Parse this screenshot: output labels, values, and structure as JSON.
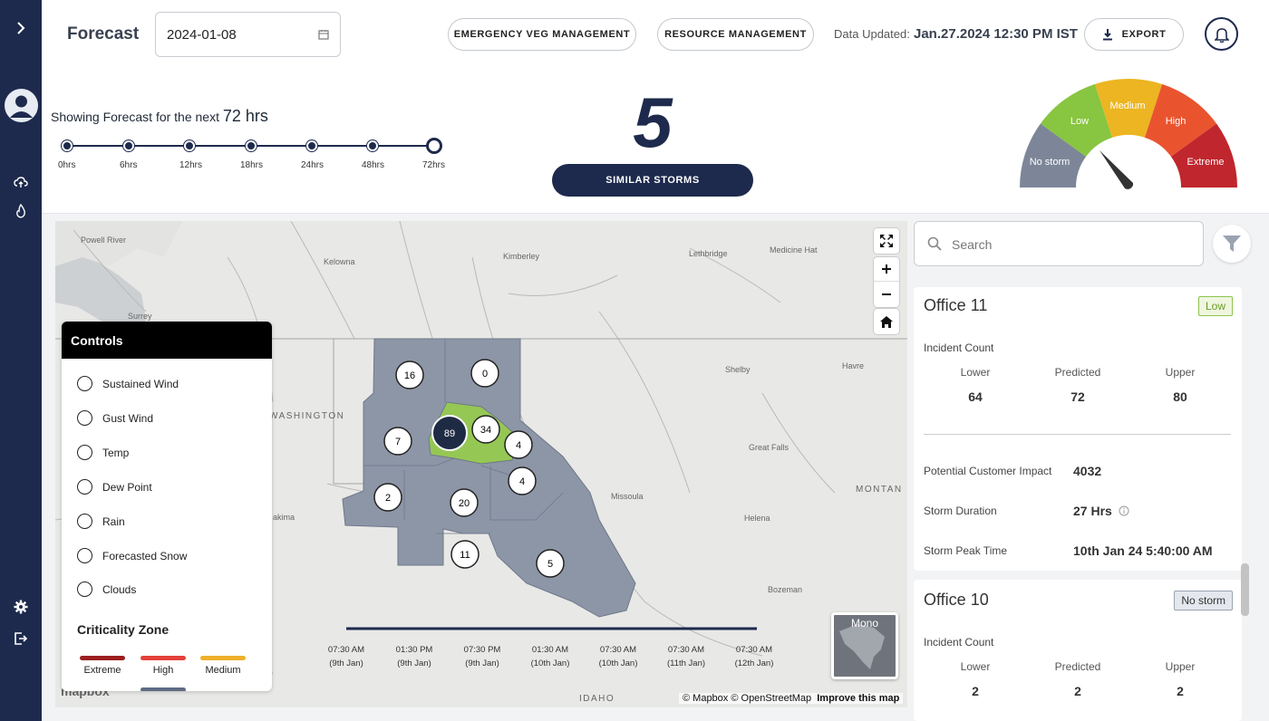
{
  "header": {
    "title": "Forecast",
    "date_value": "2024-01-08",
    "emergency_btn": "EMERGENCY VEG MANAGEMENT",
    "resource_btn": "RESOURCE MANAGEMENT",
    "data_updated_label": "Data Updated:",
    "data_updated_value": "Jan.27.2024 12:30 PM IST",
    "export_btn": "EXPORT"
  },
  "forecast": {
    "prefix": "Showing Forecast for the next",
    "hours": "72 hrs",
    "timeline_labels": [
      "0hrs",
      "6hrs",
      "12hrs",
      "18hrs",
      "24hrs",
      "48hrs",
      "72hrs"
    ]
  },
  "storms": {
    "count": "5",
    "similar_btn": "SIMILAR STORMS"
  },
  "gauge": {
    "labels": [
      "No storm",
      "Low",
      "Medium",
      "High",
      "Extreme"
    ],
    "colors": [
      "#7d8698",
      "#88c540",
      "#ecb521",
      "#e9542f",
      "#c0262d"
    ]
  },
  "map": {
    "place_labels": [
      "Powell River",
      "Kelowna",
      "Surrey",
      "Kimberley",
      "Lethbridge",
      "Medicine Hat",
      "Shelby",
      "Havre",
      "WASHINGTON",
      "Great Falls",
      "Missoula",
      "MONTAN",
      "Helena",
      "akima",
      "Bozeman",
      "IDAHO"
    ],
    "clusters": [
      "16",
      "0",
      "89",
      "34",
      "7",
      "4",
      "4",
      "2",
      "20",
      "11",
      "5"
    ],
    "time_labels": [
      [
        "07:30 AM",
        "(9th Jan)"
      ],
      [
        "01:30 PM",
        "(9th Jan)"
      ],
      [
        "07:30 PM",
        "(9th Jan)"
      ],
      [
        "01:30 AM",
        "(10th Jan)"
      ],
      [
        "07:30 AM",
        "(10th Jan)"
      ],
      [
        "07:30 AM",
        "(11th Jan)"
      ],
      [
        "07:30 AM",
        "(12th Jan)"
      ]
    ],
    "mini_map_label": "Mono",
    "attribution": "© Mapbox © OpenStreetMap",
    "improve": "Improve this map",
    "logo": "mapbox"
  },
  "controls": {
    "title": "Controls",
    "items": [
      "Sustained Wind",
      "Gust Wind",
      "Temp",
      "Dew Point",
      "Rain",
      "Forecasted Snow",
      "Clouds"
    ],
    "criticality_title": "Criticality Zone",
    "zones": [
      {
        "label": "Extreme",
        "color": "#9c1f1f"
      },
      {
        "label": "High",
        "color": "#e2413a"
      },
      {
        "label": "Medium",
        "color": "#efb02b"
      }
    ]
  },
  "panel": {
    "search_placeholder": "Search",
    "cards": [
      {
        "name": "Office 11",
        "badge": "Low",
        "incident_label": "Incident Count",
        "cols": [
          "Lower",
          "Predicted",
          "Upper"
        ],
        "values": [
          "64",
          "72",
          "80"
        ],
        "impact_label": "Potential Customer Impact",
        "impact_value": "4032",
        "duration_label": "Storm Duration",
        "duration_value": "27 Hrs",
        "peak_label": "Storm Peak Time",
        "peak_value": "10th Jan 24 5:40:00 AM"
      },
      {
        "name": "Office 10",
        "badge": "No storm",
        "incident_label": "Incident Count",
        "cols": [
          "Lower",
          "Predicted",
          "Upper"
        ],
        "values": [
          "2",
          "2",
          "2"
        ]
      }
    ]
  }
}
